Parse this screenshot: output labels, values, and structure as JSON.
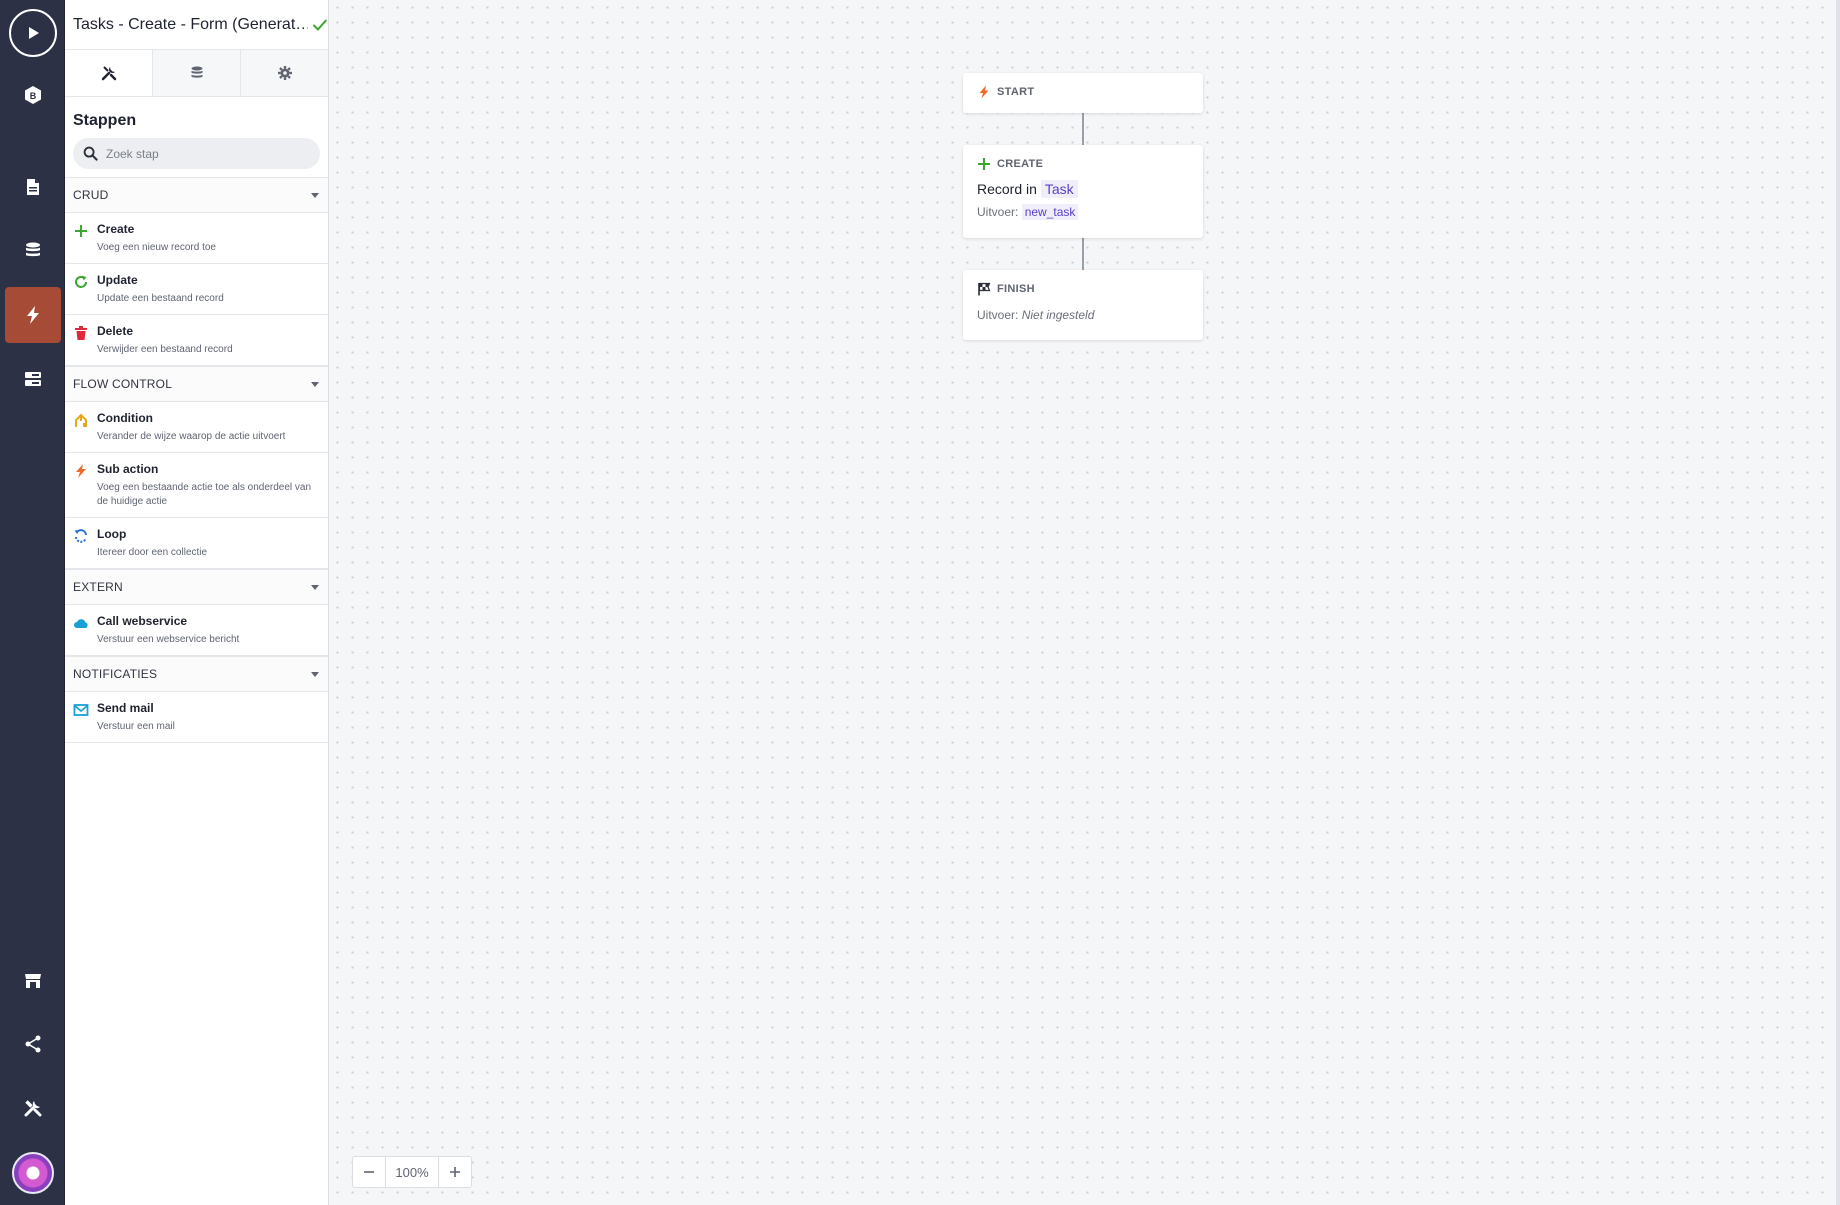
{
  "header": {
    "title": "Tasks - Create - Form (Generat…"
  },
  "panel": {
    "heading": "Stappen",
    "search": {
      "placeholder": "Zoek stap",
      "value": ""
    },
    "groups": [
      {
        "title": "CRUD",
        "steps": [
          {
            "label": "Create",
            "desc": "Voeg een nieuw record toe"
          },
          {
            "label": "Update",
            "desc": "Update een bestaand record"
          },
          {
            "label": "Delete",
            "desc": "Verwijder een bestaand record"
          }
        ]
      },
      {
        "title": "FLOW CONTROL",
        "steps": [
          {
            "label": "Condition",
            "desc": "Verander de wijze waarop de actie uitvoert"
          },
          {
            "label": "Sub action",
            "desc": "Voeg een bestaande actie toe als onderdeel van de huidige actie"
          },
          {
            "label": "Loop",
            "desc": "Itereer door een collectie"
          }
        ]
      },
      {
        "title": "EXTERN",
        "steps": [
          {
            "label": "Call webservice",
            "desc": "Verstuur een webservice bericht"
          }
        ]
      },
      {
        "title": "NOTIFICATIES",
        "steps": [
          {
            "label": "Send mail",
            "desc": "Verstuur een mail"
          }
        ]
      }
    ]
  },
  "canvas": {
    "start": {
      "kind": "START"
    },
    "create": {
      "kind": "CREATE",
      "record_prefix": "Record in",
      "record_model": "Task",
      "output_label": "Uitvoer:",
      "output_value": "new_task"
    },
    "finish": {
      "kind": "FINISH",
      "output_label": "Uitvoer:",
      "output_value": "Niet ingesteld"
    }
  },
  "zoom": {
    "level": "100%"
  },
  "colors": {
    "rail": "#2c3146",
    "rail_active": "#a54b36",
    "accent_purple": "#5a3fc8",
    "create_green": "#3aa830",
    "delete_red": "#e0283c",
    "condition_yellow": "#e6a817",
    "subaction_orange": "#ef6a2b",
    "loop_blue": "#2a6fdb",
    "webservice_cyan": "#1aa0d8"
  }
}
